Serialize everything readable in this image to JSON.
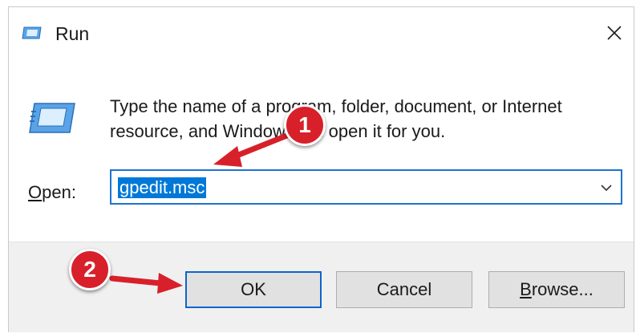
{
  "window": {
    "title": "Run",
    "close_glyph": "✕"
  },
  "content": {
    "description": "Type the name of a program, folder, document, or Internet resource, and Windows will open it for you.",
    "open_label_prefix": "",
    "open_label_mnemonic": "O",
    "open_label_rest": "pen:",
    "open_value": "gpedit.msc"
  },
  "buttons": {
    "ok_label": "OK",
    "cancel_label": "Cancel",
    "browse_mnemonic": "B",
    "browse_rest": "rowse..."
  },
  "annotations": {
    "step1": "1",
    "step2": "2",
    "marker_color": "#d8202a"
  },
  "icons": {
    "title": "run-icon",
    "dialog": "run-icon",
    "close": "close-icon",
    "dropdown": "chevron-down-icon"
  },
  "colors": {
    "accent": "#0078d7",
    "footer_bg": "#f0f0f0",
    "button_bg": "#e1e1e1"
  }
}
